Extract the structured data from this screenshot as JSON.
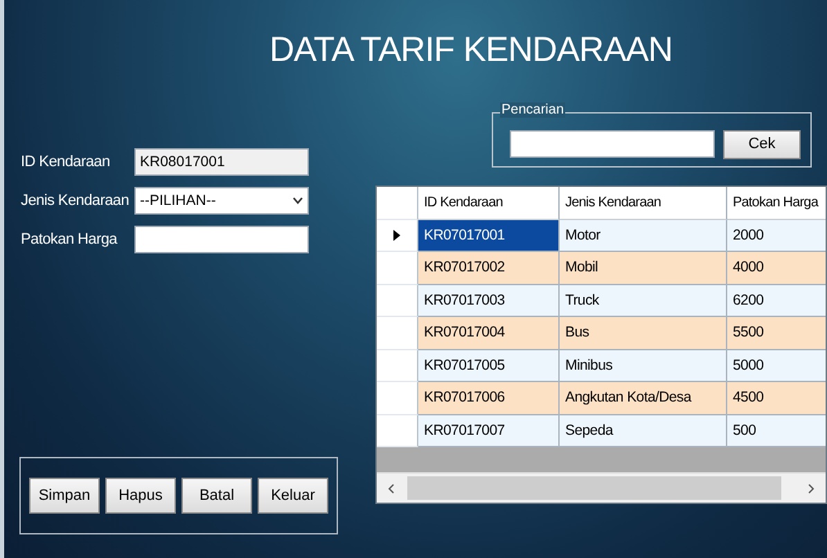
{
  "title": "DATA TARIF KENDARAAN",
  "form": {
    "fields": [
      {
        "kind": "readonly",
        "label": "ID Kendaraan",
        "value": "KR08017001"
      },
      {
        "kind": "dropdown",
        "label": "Jenis Kendaraan",
        "value": "--PILIHAN--"
      },
      {
        "kind": "text",
        "label": "Patokan Harga"
      }
    ]
  },
  "search": {
    "legend": "Pencarian",
    "button": "Cek"
  },
  "table": {
    "columns": [
      "ID Kendaraan",
      "Jenis Kendaraan",
      "Patokan Harga"
    ],
    "rows": [
      {
        "cells": [
          "KR07017001",
          "Motor",
          "2000"
        ],
        "selected": true
      },
      {
        "cells": [
          "KR07017002",
          "Mobil",
          "4000"
        ],
        "selected": false
      },
      {
        "cells": [
          "KR07017003",
          "Truck",
          "6200"
        ],
        "selected": false
      },
      {
        "cells": [
          "KR07017004",
          "Bus",
          "5500"
        ],
        "selected": false
      },
      {
        "cells": [
          "KR07017005",
          "Minibus",
          "5000"
        ],
        "selected": false
      },
      {
        "cells": [
          "KR07017006",
          "Angkutan Kota/Desa",
          "4500"
        ],
        "selected": false
      },
      {
        "cells": [
          "KR07017007",
          "Sepeda",
          "500"
        ],
        "selected": false
      }
    ]
  },
  "buttons": [
    "Simpan",
    "Hapus",
    "Batal",
    "Keluar"
  ]
}
